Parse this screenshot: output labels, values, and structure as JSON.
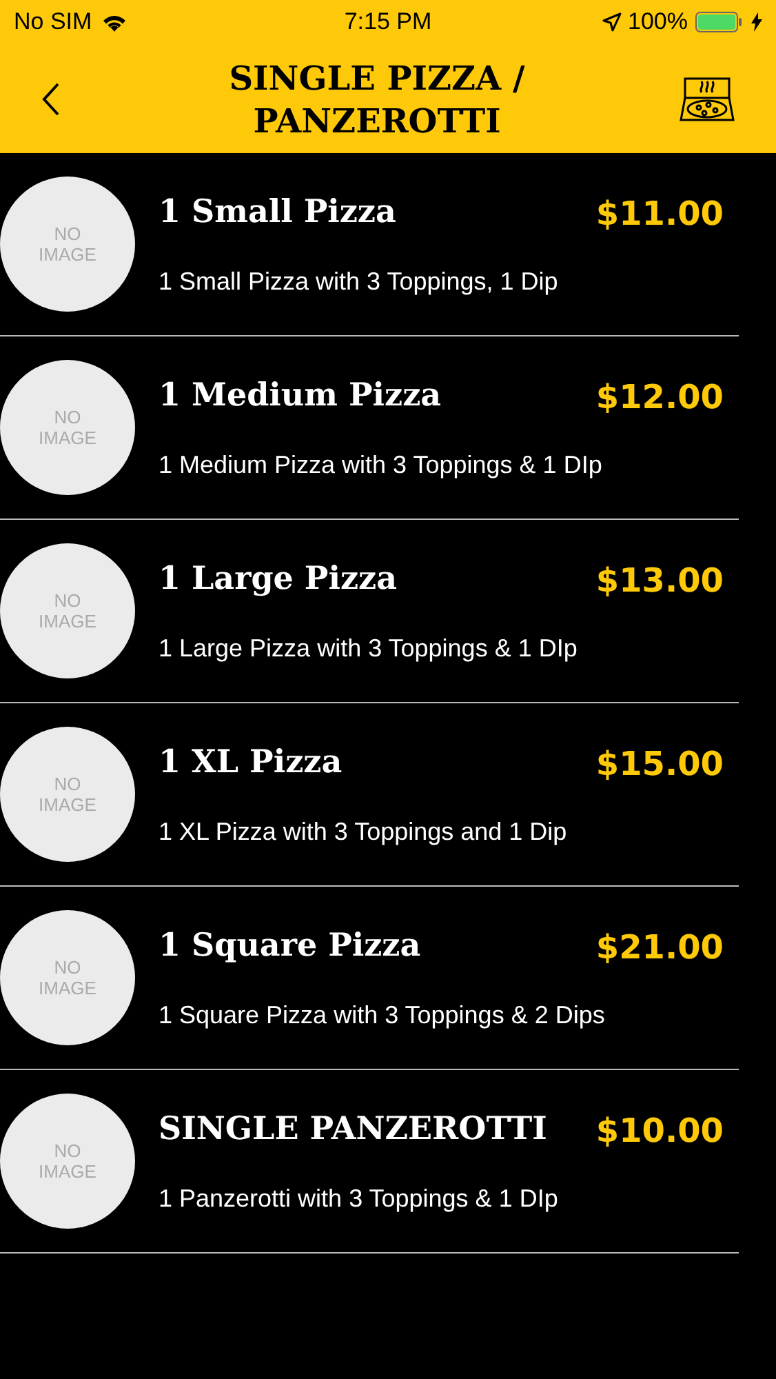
{
  "status_bar": {
    "carrier": "No SIM",
    "time": "7:15 PM",
    "battery": "100%"
  },
  "header": {
    "title": "SINGLE PIZZA / PANZEROTTI"
  },
  "items": [
    {
      "image_text": "NO IMAGE",
      "name": "1 Small Pizza",
      "price": "$11.00",
      "description": "1 Small Pizza with 3 Toppings, 1 Dip"
    },
    {
      "image_text": "NO IMAGE",
      "name": "1 Medium Pizza",
      "price": "$12.00",
      "description": "1 Medium Pizza with 3 Toppings & 1 DIp"
    },
    {
      "image_text": "NO IMAGE",
      "name": "1 Large Pizza",
      "price": "$13.00",
      "description": "1 Large Pizza with 3 Toppings & 1 DIp"
    },
    {
      "image_text": "NO IMAGE",
      "name": "1 XL Pizza",
      "price": "$15.00",
      "description": "1 XL Pizza with 3 Toppings and 1 Dip"
    },
    {
      "image_text": "NO IMAGE",
      "name": "1 Square Pizza",
      "price": "$21.00",
      "description": "1 Square Pizza with 3 Toppings & 2 Dips"
    },
    {
      "image_text": "NO IMAGE",
      "name": "SINGLE PANZEROTTI",
      "price": "$10.00",
      "description": "1 Panzerotti with 3 Toppings & 1 DIp"
    }
  ]
}
